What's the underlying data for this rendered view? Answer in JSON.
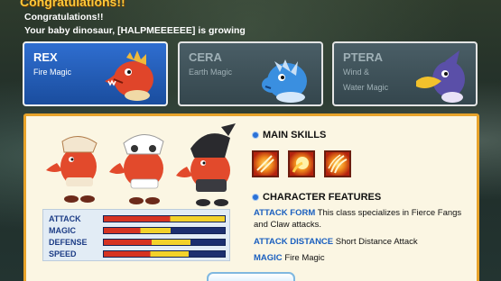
{
  "header": {
    "title": "Congratulations!!",
    "line1": "Congratulations!!",
    "line2": "Your baby dinosaur, [HALPMEEEEEE] is growing"
  },
  "classes": [
    {
      "name": "REX",
      "element": "Fire Magic",
      "selected": true
    },
    {
      "name": "CERA",
      "element": "Earth Magic",
      "selected": false
    },
    {
      "name": "PTERA",
      "element_line1": "Wind &",
      "element_line2": "Water Magic",
      "selected": false
    }
  ],
  "stats": [
    {
      "label": "ATTACK",
      "level": 1.0
    },
    {
      "label": "MAGIC",
      "level": 0.55
    },
    {
      "label": "DEFENSE",
      "level": 0.72
    },
    {
      "label": "SPEED",
      "level": 0.7
    }
  ],
  "main_skills": {
    "heading": "MAIN SKILLS",
    "icons": [
      "claw-slash-icon",
      "fireball-icon",
      "fire-claw-icon"
    ]
  },
  "features": {
    "heading": "CHARACTER FEATURES",
    "items": [
      {
        "key": "ATTACK FORM",
        "value": "This class specializes in Fierce Fangs and Claw attacks."
      },
      {
        "key": "ATTACK DISTANCE",
        "value": "Short Distance Attack"
      },
      {
        "key": "MAGIC",
        "value": "Fire Magic"
      }
    ]
  },
  "colors": {
    "accent_gold": "#ffc83a",
    "panel_border": "#e7a32a",
    "feature_key": "#1a5fbf",
    "card_active": "#2f6ed0"
  }
}
